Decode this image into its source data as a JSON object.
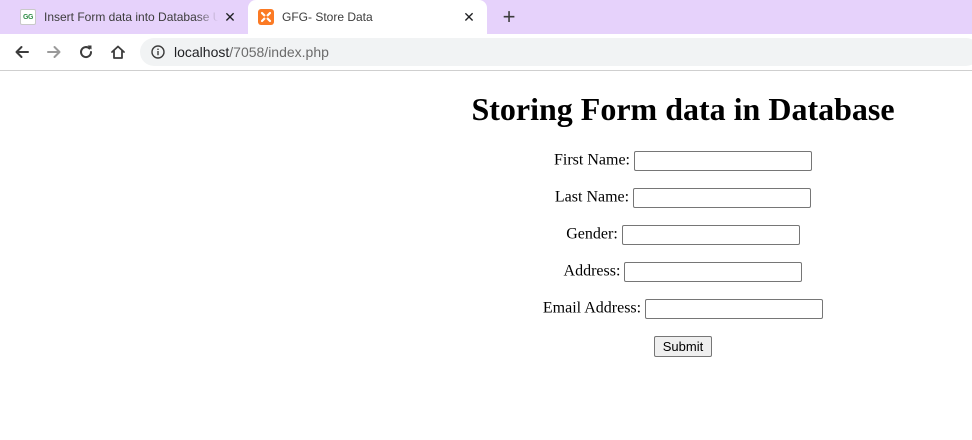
{
  "browser": {
    "tabs": [
      {
        "title": "Insert Form data into Database U",
        "favicon": "geeksforgeeks-logo",
        "favicon_text": "GG",
        "active": false
      },
      {
        "title": "GFG- Store Data",
        "favicon": "xampp-logo",
        "active": true
      }
    ],
    "close_glyph": "✕",
    "new_tab_glyph": "+",
    "address": {
      "host": "localhost",
      "path": "/7058/index.php"
    },
    "icons": {
      "back": "back-arrow-icon",
      "forward": "forward-arrow-icon",
      "reload": "reload-icon",
      "home": "home-icon",
      "info": "info-icon"
    }
  },
  "page": {
    "title": "Storing Form data in Database",
    "fields": [
      {
        "label": "First Name:",
        "value": ""
      },
      {
        "label": "Last Name:",
        "value": ""
      },
      {
        "label": "Gender:",
        "value": ""
      },
      {
        "label": "Address:",
        "value": ""
      },
      {
        "label": "Email Address:",
        "value": ""
      }
    ],
    "submit_label": "Submit"
  },
  "colors": {
    "tabstrip": "#e6d2fb",
    "omnibox": "#f1f3f4",
    "xampp_orange": "#fb7a24",
    "gfg_green": "#2f8d46"
  }
}
